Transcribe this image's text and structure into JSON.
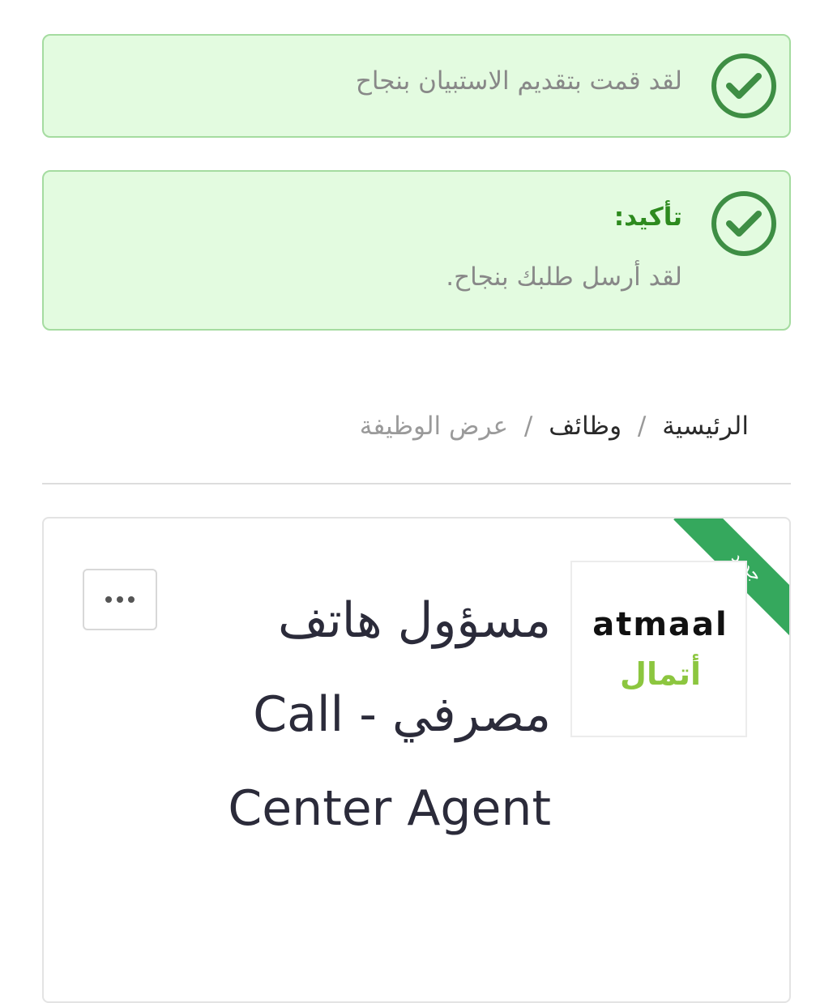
{
  "alerts": [
    {
      "text": "لقد قمت بتقديم الاستبيان بنجاح",
      "icon": "check-circle-icon"
    },
    {
      "title": "تأكيد:",
      "text": "لقد أرسل طلبك بنجاح.",
      "icon": "check-circle-icon"
    }
  ],
  "breadcrumb": {
    "home": "الرئيسية",
    "jobs": "وظائف",
    "current": "عرض الوظيفة",
    "separator": "/"
  },
  "job": {
    "badge": "جديد",
    "title": "مسؤول هاتف مصرفي - Call Center Agent",
    "company_logo": {
      "latin": "atmaal",
      "arabic": "أتمال"
    },
    "more_icon": "ellipsis-icon"
  },
  "colors": {
    "success_bg": "#e3fbe0",
    "success_border": "#a5dca0",
    "success_icon": "#3e8e44",
    "title_green": "#2d8a1e",
    "badge_green": "#35a85d",
    "logo_green": "#8cc63f"
  }
}
